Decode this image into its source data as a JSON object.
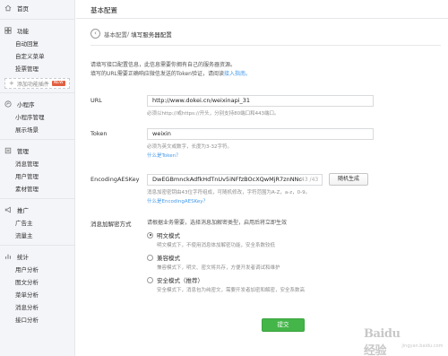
{
  "sidebar": {
    "home": "首页",
    "sections": [
      {
        "title": "功能",
        "icon": "function-icon",
        "items": [
          "自动回复",
          "自定义菜单",
          "投票管理"
        ]
      },
      {
        "title": "小程序",
        "icon": "miniprogram-icon",
        "items": [
          "小程序管理",
          "展示场景"
        ]
      },
      {
        "title": "管理",
        "icon": "manage-icon",
        "items": [
          "消息管理",
          "用户管理",
          "素材管理"
        ]
      },
      {
        "title": "推广",
        "icon": "promote-icon",
        "items": [
          "广告主",
          "流量主"
        ]
      },
      {
        "title": "统计",
        "icon": "stats-icon",
        "items": [
          "用户分析",
          "图文分析",
          "菜单分析",
          "消息分析",
          "接口分析"
        ]
      }
    ],
    "add_plugin": "添加功能插件",
    "new_badge": "NEW"
  },
  "header": {
    "title": "基本配置"
  },
  "breadcrumb": {
    "parent": "基本配置",
    "separator": "/",
    "current": "填写服务器配置"
  },
  "intro": {
    "line1": "请填写接口配置信息，此信息需要你拥有自己的服务器资源。",
    "line2": "填写的URL需要正确响应微信发送的Token验证，请阅读",
    "link": "接入指南。"
  },
  "form": {
    "url": {
      "label": "URL",
      "value": "http://www.dokei.cn/weixinapi_31",
      "hint": "必须以http://或https://开头，分别支持80端口和443端口。"
    },
    "token": {
      "label": "Token",
      "value": "weixin",
      "hint": "必须为英文或数字，长度为3-32字符。",
      "link": "什么是Token？"
    },
    "aes": {
      "label": "EncodingAESKey",
      "value": "DwEGBmnckAdfkHdTnUv5iNFfzBOcXQwMjR7znNNc",
      "counter": "43 /43",
      "random_button": "随机生成",
      "hint": "消息加密密钥由43位字符组成，可随机修改，字符范围为A-Z，a-z，0-9。",
      "link": "什么是EncodingAESKey？"
    },
    "encrypt": {
      "label": "消息加解密方式",
      "hint": "请根据业务需要，选择消息加解密类型，启用后将立即生效",
      "options": [
        {
          "label": "明文模式",
          "desc": "明文模式下，不使用消息体加解密功能，安全系数较低",
          "selected": true
        },
        {
          "label": "兼容模式",
          "desc": "兼容模式下，明文、密文将共存，方便开发者调试和维护",
          "selected": false
        },
        {
          "label": "安全模式（推荐）",
          "desc": "安全模式下，消息包为纯密文，需要开发者加密和解密，安全系数高",
          "selected": false
        }
      ]
    },
    "submit": "提交"
  },
  "watermark": {
    "logo": "Baidu经验",
    "sub": "jingyan.baidu.com"
  }
}
